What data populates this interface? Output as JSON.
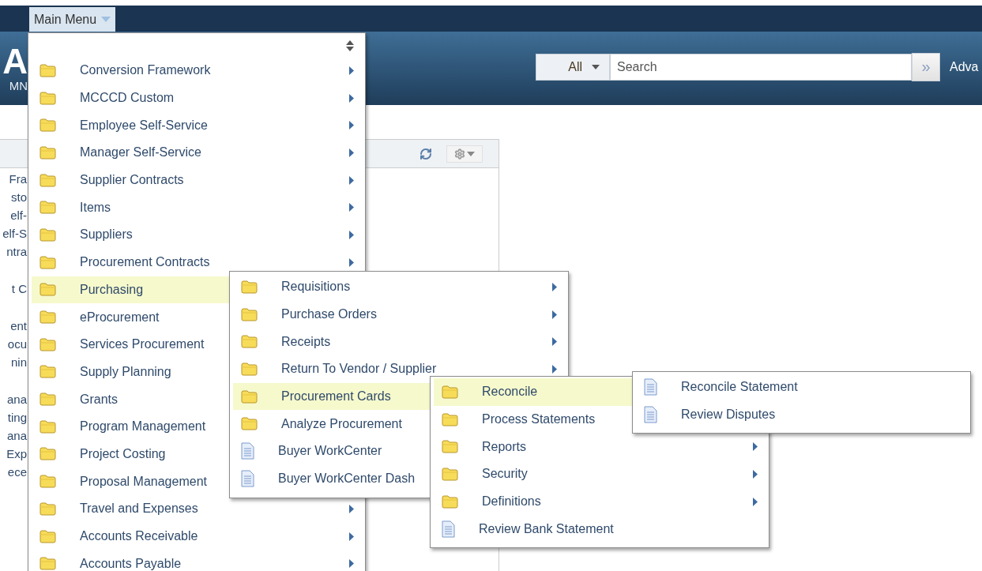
{
  "top_bar": {
    "main_menu": "Main Menu"
  },
  "banner": {
    "logo_fragment": "A",
    "subtitle_fragment": "MN",
    "search": {
      "scope": "All",
      "placeholder": "Search",
      "go": "»",
      "advanced_link": "Adva"
    }
  },
  "pagelet": {
    "column_fragments": [
      [
        "Fra",
        "sto",
        "elf-",
        "elf-S",
        "ntra"
      ],
      [
        "t C"
      ],
      [
        "ent",
        "ocu",
        "nin"
      ],
      [
        "ana",
        "ting",
        "ana",
        "Exp",
        "ece"
      ]
    ]
  },
  "menus": [
    {
      "items": [
        {
          "kind": "folder",
          "label": "Conversion Framework",
          "submenu_arrow": true,
          "selected": false
        },
        {
          "kind": "folder",
          "label": "MCCCD Custom",
          "submenu_arrow": true,
          "selected": false
        },
        {
          "kind": "folder",
          "label": "Employee Self-Service",
          "submenu_arrow": true,
          "selected": false
        },
        {
          "kind": "folder",
          "label": "Manager Self-Service",
          "submenu_arrow": true,
          "selected": false
        },
        {
          "kind": "folder",
          "label": "Supplier Contracts",
          "submenu_arrow": true,
          "selected": false
        },
        {
          "kind": "folder",
          "label": "Items",
          "submenu_arrow": true,
          "selected": false
        },
        {
          "kind": "folder",
          "label": "Suppliers",
          "submenu_arrow": true,
          "selected": false
        },
        {
          "kind": "folder",
          "label": "Procurement Contracts",
          "submenu_arrow": true,
          "selected": false
        },
        {
          "kind": "folder",
          "label": "Purchasing",
          "submenu_arrow": false,
          "selected": true
        },
        {
          "kind": "folder",
          "label": "eProcurement",
          "submenu_arrow": false,
          "selected": false
        },
        {
          "kind": "folder",
          "label": "Services Procurement",
          "submenu_arrow": false,
          "selected": false
        },
        {
          "kind": "folder",
          "label": "Supply Planning",
          "submenu_arrow": false,
          "selected": false
        },
        {
          "kind": "folder",
          "label": "Grants",
          "submenu_arrow": false,
          "selected": false
        },
        {
          "kind": "folder",
          "label": "Program Management",
          "submenu_arrow": false,
          "selected": false
        },
        {
          "kind": "folder",
          "label": "Project Costing",
          "submenu_arrow": false,
          "selected": false
        },
        {
          "kind": "folder",
          "label": "Proposal Management",
          "submenu_arrow": false,
          "selected": false
        },
        {
          "kind": "folder",
          "label": "Travel and Expenses",
          "submenu_arrow": true,
          "selected": false
        },
        {
          "kind": "folder",
          "label": "Accounts Receivable",
          "submenu_arrow": true,
          "selected": false
        },
        {
          "kind": "folder",
          "label": "Accounts Payable",
          "submenu_arrow": true,
          "selected": false
        }
      ]
    },
    {
      "items": [
        {
          "kind": "folder",
          "label": "Requisitions",
          "submenu_arrow": true,
          "selected": false
        },
        {
          "kind": "folder",
          "label": "Purchase Orders",
          "submenu_arrow": true,
          "selected": false
        },
        {
          "kind": "folder",
          "label": "Receipts",
          "submenu_arrow": true,
          "selected": false
        },
        {
          "kind": "folder",
          "label": "Return To Vendor / Supplier",
          "submenu_arrow": true,
          "selected": false
        },
        {
          "kind": "folder",
          "label": "Procurement Cards",
          "submenu_arrow": false,
          "selected": true
        },
        {
          "kind": "folder",
          "label": "Analyze Procurement",
          "submenu_arrow": false,
          "selected": false
        },
        {
          "kind": "page",
          "label": "Buyer WorkCenter",
          "submenu_arrow": false,
          "selected": false
        },
        {
          "kind": "page",
          "label": "Buyer WorkCenter Dash",
          "submenu_arrow": false,
          "selected": false
        }
      ]
    },
    {
      "items": [
        {
          "kind": "folder",
          "label": "Reconcile",
          "submenu_arrow": false,
          "selected": true
        },
        {
          "kind": "folder",
          "label": "Process Statements",
          "submenu_arrow": false,
          "selected": false
        },
        {
          "kind": "folder",
          "label": "Reports",
          "submenu_arrow": true,
          "selected": false
        },
        {
          "kind": "folder",
          "label": "Security",
          "submenu_arrow": true,
          "selected": false
        },
        {
          "kind": "folder",
          "label": "Definitions",
          "submenu_arrow": true,
          "selected": false
        },
        {
          "kind": "page",
          "label": "Review Bank Statement",
          "submenu_arrow": false,
          "selected": false
        }
      ]
    },
    {
      "items": [
        {
          "kind": "page",
          "label": "Reconcile Statement",
          "submenu_arrow": false,
          "selected": false
        },
        {
          "kind": "page",
          "label": "Review Disputes",
          "submenu_arrow": false,
          "selected": false
        }
      ]
    }
  ]
}
